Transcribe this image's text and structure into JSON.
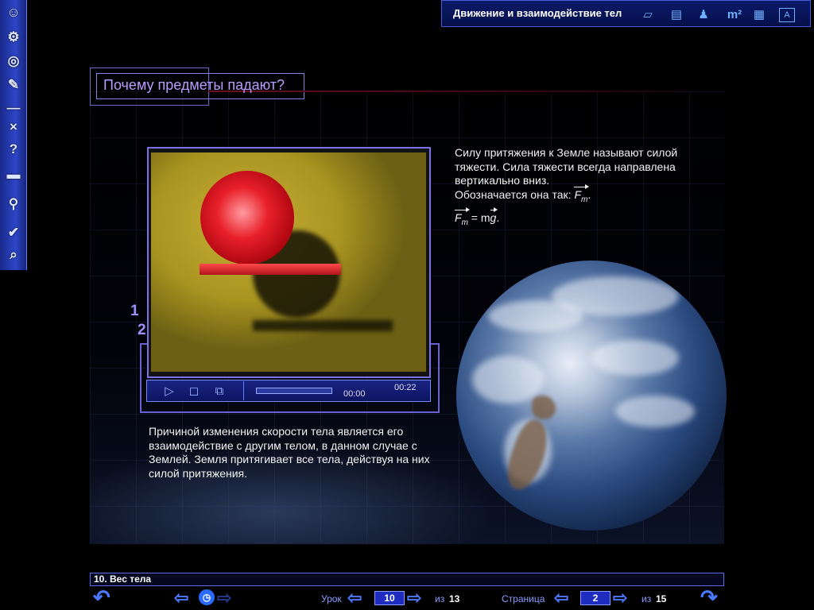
{
  "window": {
    "title": "Движение и взаимодействие тел"
  },
  "toolbar": {
    "left": [
      "people-icon",
      "gears-icon",
      "discs-icon",
      "pen-icon",
      "minimize-icon",
      "close-icon",
      "help-icon",
      "book-icon",
      "pin-icon",
      "check-icon",
      "magnifier-icon"
    ],
    "left_glyphs": [
      "☺",
      "⚙",
      "◎",
      "✎",
      "—",
      "×",
      "?",
      "▬",
      "⚲",
      "✔",
      "⌕"
    ],
    "top": [
      "notepad-icon",
      "page-icon",
      "person-icon",
      "units-icon",
      "table-icon",
      "font-icon"
    ],
    "top_glyphs": [
      "▱",
      "▤",
      "♟",
      "m²",
      "▦",
      "A"
    ]
  },
  "page": {
    "title": "Почему предметы падают?",
    "markers": [
      "1",
      "2"
    ],
    "para1_line1": "Силу притяжения к Земле называют силой тяжести. Сила тяжести всегда направлена вертикально вниз.",
    "para1_prefix": "Обозначается она так: ",
    "symbol_F": "F",
    "symbol_sub": "т",
    "formula_eq": " = m",
    "symbol_g": "g",
    "formula_end": ".",
    "para1_dot": ".",
    "para2": "Причиной изменения скорости тела является его взаимодействие с другим телом, в данном случае с Землей. Земля притягивает все тела, действуя на них силой притяжения."
  },
  "video": {
    "time_current": "00:00",
    "time_total": "00:22",
    "progress": 0.0,
    "buttons": [
      "play-icon",
      "stop-icon",
      "window-icon"
    ]
  },
  "footer": {
    "lesson_title": "10. Вес тела",
    "lesson_label": "Урок",
    "lesson_current": "10",
    "of_label": "из",
    "lesson_total": "13",
    "page_label": "Страница",
    "page_current": "2",
    "page_total": "15"
  }
}
